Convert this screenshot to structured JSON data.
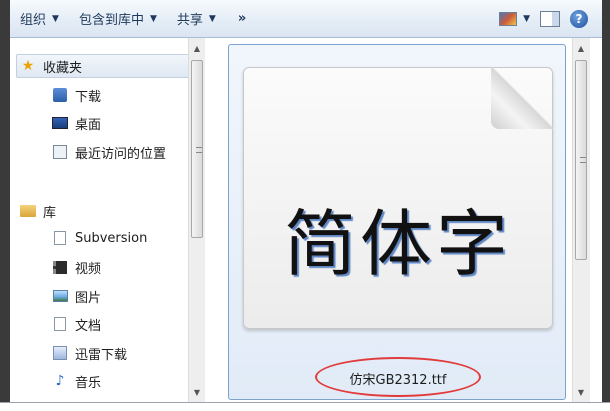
{
  "toolbar": {
    "organize": "组织",
    "include_in_library": "包含到库中",
    "share": "共享",
    "more": "»"
  },
  "nav": {
    "favorites": "收藏夹",
    "downloads": "下载",
    "desktop": "桌面",
    "recent_places": "最近访问的位置",
    "libraries": "库",
    "subversion": "Subversion",
    "videos": "视频",
    "pictures": "图片",
    "documents": "文档",
    "thunder_downloads": "迅雷下载",
    "music": "音乐"
  },
  "content": {
    "preview_text": "简体字",
    "file_name": "仿宋GB2312.ttf"
  },
  "colors": {
    "highlight_ellipse": "#e13b3b",
    "selection_border": "#7da2ce",
    "glyph_shadow": "#5f86c4"
  },
  "icons": [
    "star-icon",
    "downloads-icon",
    "desktop-icon",
    "recent-places-icon",
    "libraries-icon",
    "subversion-icon",
    "video-icon",
    "pictures-icon",
    "documents-icon",
    "thunder-icon",
    "music-icon",
    "change-view-icon",
    "preview-pane-icon",
    "help-icon"
  ]
}
